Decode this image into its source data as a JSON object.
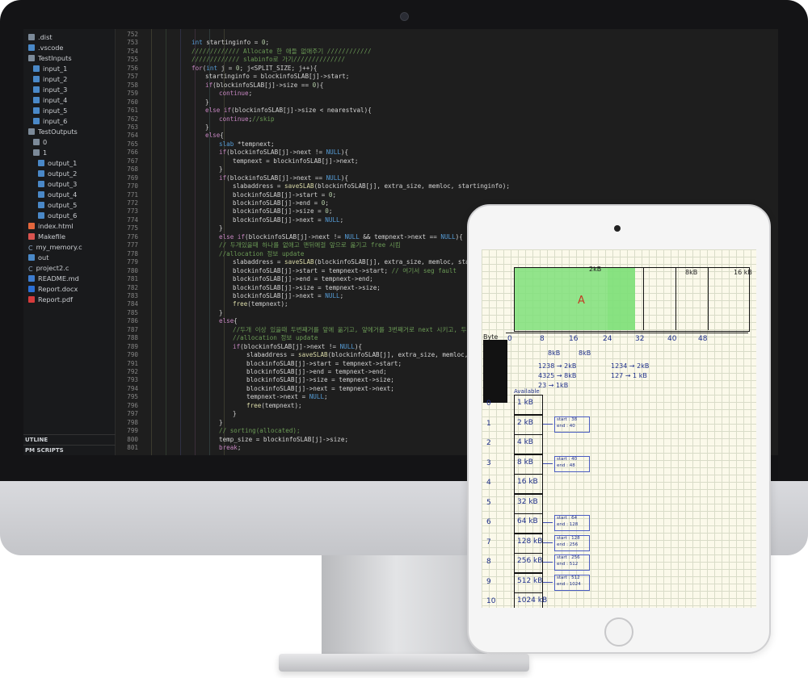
{
  "explorer": {
    "items": [
      {
        "label": ".dist",
        "icon": "folder-icon",
        "indent": 0
      },
      {
        "label": ".vscode",
        "icon": "vscode-icon",
        "indent": 0
      },
      {
        "label": "TestInputs",
        "icon": "folder-icon",
        "indent": 0
      },
      {
        "label": "input_1",
        "icon": "file-icon",
        "indent": 1
      },
      {
        "label": "input_2",
        "icon": "file-icon",
        "indent": 1
      },
      {
        "label": "input_3",
        "icon": "file-icon",
        "indent": 1
      },
      {
        "label": "input_4",
        "icon": "file-icon",
        "indent": 1
      },
      {
        "label": "input_5",
        "icon": "file-icon",
        "indent": 1
      },
      {
        "label": "input_6",
        "icon": "file-icon",
        "indent": 1
      },
      {
        "label": "TestOutputs",
        "icon": "folder-icon",
        "indent": 0
      },
      {
        "label": "0",
        "icon": "folder-icon",
        "indent": 1
      },
      {
        "label": "1",
        "icon": "folder-icon",
        "indent": 1
      },
      {
        "label": "output_1",
        "icon": "file-icon",
        "indent": 2
      },
      {
        "label": "output_2",
        "icon": "file-icon",
        "indent": 2
      },
      {
        "label": "output_3",
        "icon": "file-icon",
        "indent": 2
      },
      {
        "label": "output_4",
        "icon": "file-icon",
        "indent": 2
      },
      {
        "label": "output_5",
        "icon": "file-icon",
        "indent": 2
      },
      {
        "label": "output_6",
        "icon": "file-icon",
        "indent": 2
      },
      {
        "label": "index.html",
        "icon": "html-icon",
        "indent": 0
      },
      {
        "label": "Makefile",
        "icon": "makefile-icon",
        "indent": 0
      },
      {
        "label": "my_memory.c",
        "icon": "c-file-icon",
        "indent": 0
      },
      {
        "label": "out",
        "icon": "file-icon",
        "indent": 0
      },
      {
        "label": "project2.c",
        "icon": "c-file-icon",
        "indent": 0
      },
      {
        "label": "README.md",
        "icon": "markdown-icon",
        "indent": 0
      },
      {
        "label": "Report.docx",
        "icon": "docx-icon",
        "indent": 0
      },
      {
        "label": "Report.pdf",
        "icon": "pdf-icon",
        "indent": 0
      }
    ],
    "outline_label": "UTLINE",
    "npm_label": "PM SCRIPTS"
  },
  "editor": {
    "lines": [
      {
        "n": "752",
        "indent": 0,
        "text": ""
      },
      {
        "n": "753",
        "indent": 2,
        "text": "int startinginfo = 0;"
      },
      {
        "n": "754",
        "indent": 2,
        "text": "///////////// Allocate 한 애들 없애주기 ////////////"
      },
      {
        "n": "755",
        "indent": 2,
        "text": "///////////// slabinfo로 가기//////////////"
      },
      {
        "n": "756",
        "indent": 2,
        "text": "for(int j = 0; j<SPLIT_SIZE; j++){"
      },
      {
        "n": "757",
        "indent": 3,
        "text": "startinginfo = blockinfoSLAB[j]->start;"
      },
      {
        "n": "758",
        "indent": 3,
        "text": "if(blockinfoSLAB[j]->size == 0){"
      },
      {
        "n": "759",
        "indent": 4,
        "text": "continue;"
      },
      {
        "n": "760",
        "indent": 3,
        "text": "}"
      },
      {
        "n": "761",
        "indent": 3,
        "text": "else if(blockinfoSLAB[j]->size < nearestval){"
      },
      {
        "n": "762",
        "indent": 4,
        "text": "continue;//skip"
      },
      {
        "n": "763",
        "indent": 3,
        "text": "}"
      },
      {
        "n": "764",
        "indent": 3,
        "text": "else{"
      },
      {
        "n": "765",
        "indent": 4,
        "text": "slab *tempnext;"
      },
      {
        "n": "766",
        "indent": 4,
        "text": "if(blockinfoSLAB[j]->next != NULL){"
      },
      {
        "n": "767",
        "indent": 5,
        "text": "tempnext = blockinfoSLAB[j]->next;"
      },
      {
        "n": "768",
        "indent": 4,
        "text": "}"
      },
      {
        "n": "769",
        "indent": 4,
        "text": "if(blockinfoSLAB[j]->next == NULL){"
      },
      {
        "n": "770",
        "indent": 5,
        "text": "slabaddress = saveSLAB(blockinfoSLAB[j], extra_size, memloc, startinginfo);"
      },
      {
        "n": "771",
        "indent": 5,
        "text": "blockinfoSLAB[j]->start = 0;"
      },
      {
        "n": "772",
        "indent": 5,
        "text": "blockinfoSLAB[j]->end = 0;"
      },
      {
        "n": "773",
        "indent": 5,
        "text": "blockinfoSLAB[j]->size = 0;"
      },
      {
        "n": "774",
        "indent": 5,
        "text": "blockinfoSLAB[j]->next = NULL;"
      },
      {
        "n": "775",
        "indent": 4,
        "text": "}"
      },
      {
        "n": "776",
        "indent": 4,
        "text": "else if(blockinfoSLAB[j]->next != NULL && tempnext->next == NULL){"
      },
      {
        "n": "777",
        "indent": 4,
        "text": "// 두개있을때 하나를 없애고 맨뒤에걸 앞으로 옮기고 free 시킴"
      },
      {
        "n": "778",
        "indent": 4,
        "text": "//allocation 정보 update"
      },
      {
        "n": "779",
        "indent": 5,
        "text": "slabaddress = saveSLAB(blockinfoSLAB[j], extra_size, memloc, startinginfo);"
      },
      {
        "n": "780",
        "indent": 5,
        "text": "blockinfoSLAB[j]->start = tempnext->start; // 여기서 seg fault"
      },
      {
        "n": "781",
        "indent": 5,
        "text": "blockinfoSLAB[j]->end = tempnext->end;"
      },
      {
        "n": "782",
        "indent": 5,
        "text": "blockinfoSLAB[j]->size = tempnext->size;"
      },
      {
        "n": "783",
        "indent": 5,
        "text": "blockinfoSLAB[j]->next = NULL;"
      },
      {
        "n": "784",
        "indent": 5,
        "text": "free(tempnext);"
      },
      {
        "n": "785",
        "indent": 4,
        "text": "}"
      },
      {
        "n": "786",
        "indent": 4,
        "text": "else{"
      },
      {
        "n": "787",
        "indent": 5,
        "text": "//두개 이상 있을때 두번째거를 앞에 옮기고, 앞에거를 3번째거로 next 시키고, 두번째걸 free"
      },
      {
        "n": "788",
        "indent": 5,
        "text": "//allocation 정보 update"
      },
      {
        "n": "789",
        "indent": 5,
        "text": "if(blockinfoSLAB[j]->next != NULL){"
      },
      {
        "n": "790",
        "indent": 6,
        "text": "slabaddress = saveSLAB(blockinfoSLAB[j], extra_size, memloc, sta"
      },
      {
        "n": "791",
        "indent": 6,
        "text": "blockinfoSLAB[j]->start = tempnext->start;"
      },
      {
        "n": "792",
        "indent": 6,
        "text": "blockinfoSLAB[j]->end = tempnext->end;"
      },
      {
        "n": "793",
        "indent": 6,
        "text": "blockinfoSLAB[j]->size = tempnext->size;"
      },
      {
        "n": "794",
        "indent": 6,
        "text": "blockinfoSLAB[j]->next = tempnext->next;"
      },
      {
        "n": "795",
        "indent": 6,
        "text": "tempnext->next = NULL;"
      },
      {
        "n": "796",
        "indent": 6,
        "text": "free(tempnext);"
      },
      {
        "n": "797",
        "indent": 5,
        "text": "}"
      },
      {
        "n": "798",
        "indent": 4,
        "text": "}"
      },
      {
        "n": "799",
        "indent": 4,
        "text": "// sorting(allocated);"
      },
      {
        "n": "800",
        "indent": 4,
        "text": "temp_size = blockinfoSLAB[j]->size;"
      },
      {
        "n": "801",
        "indent": 4,
        "text": "break;"
      }
    ]
  },
  "notes": {
    "bar_labels": {
      "a": "A",
      "kb2": "2kB",
      "kb8": "8kB",
      "kb16": "16 kB"
    },
    "axis_labels": [
      "0",
      "8",
      "16",
      "24",
      "32",
      "40",
      "48"
    ],
    "byte_label": "Byte",
    "available_label": "Available",
    "col_hdr": [
      "8kB",
      "8kB"
    ],
    "pairs": [
      {
        "left": "1238 → 2kB",
        "right": "1234 → 2kB"
      },
      {
        "left": "4325 → 8kB",
        "right": "127 → 1 kB"
      },
      {
        "left": "23 → 1kB",
        "right": ""
      }
    ],
    "rows": [
      {
        "index": "0",
        "size": "1 kB"
      },
      {
        "index": "1",
        "size": "2 kB"
      },
      {
        "index": "2",
        "size": "4 kB"
      },
      {
        "index": "3",
        "size": "8 kB"
      },
      {
        "index": "4",
        "size": "16 kB"
      },
      {
        "index": "5",
        "size": "32 kB"
      },
      {
        "index": "6",
        "size": "64 kB"
      },
      {
        "index": "7",
        "size": "128 kB"
      },
      {
        "index": "8",
        "size": "256 kB"
      },
      {
        "index": "9",
        "size": "512 kB"
      },
      {
        "index": "10",
        "size": "1024 kB"
      }
    ],
    "boxes": [
      {
        "row": 1,
        "start": "start : 38",
        "end": "end : 40"
      },
      {
        "row": 3,
        "start": "start : 40",
        "end": "end : 48"
      },
      {
        "row": 6,
        "start": "start : 64",
        "end": "end : 128"
      },
      {
        "row": 7,
        "start": "start : 128",
        "end": "end : 256"
      },
      {
        "row": 8,
        "start": "start : 256",
        "end": "end : 512"
      },
      {
        "row": 9,
        "start": "start : 512",
        "end": "end : 1024"
      }
    ]
  }
}
